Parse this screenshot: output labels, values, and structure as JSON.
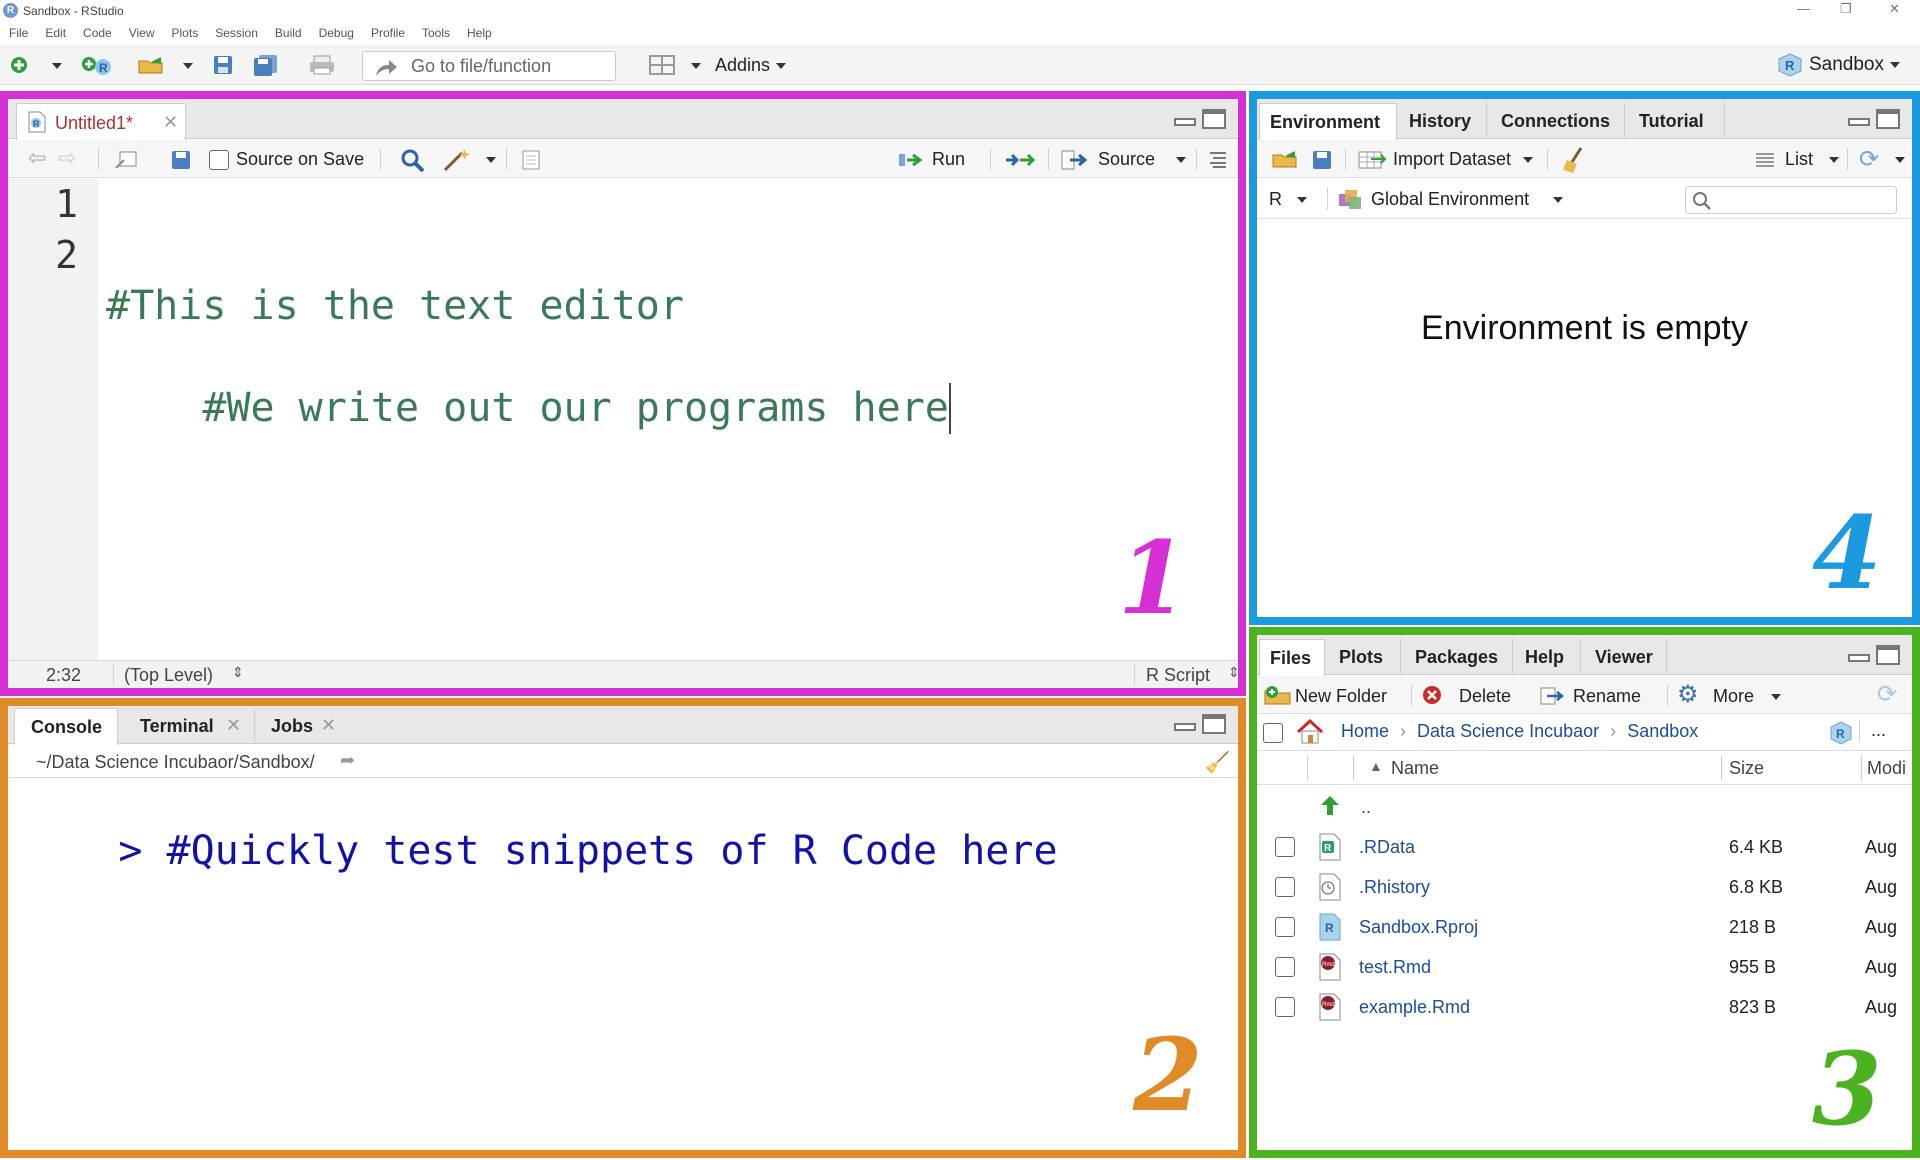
{
  "window": {
    "title": "Sandbox - RStudio"
  },
  "menu": [
    "File",
    "Edit",
    "Code",
    "View",
    "Plots",
    "Session",
    "Build",
    "Debug",
    "Profile",
    "Tools",
    "Help"
  ],
  "toolbar": {
    "goto_placeholder": "Go to file/function",
    "addins": "Addins",
    "project": "Sandbox"
  },
  "editor": {
    "tab": "Untitled1*",
    "source_on_save": "Source on Save",
    "run": "Run",
    "source": "Source",
    "lines": [
      "#This is the text editor",
      "#We write out our programs here"
    ],
    "line_numbers": [
      "1",
      "2"
    ],
    "position": "2:32",
    "scope": "(Top Level)",
    "file_type": "R Script",
    "region_number": "1"
  },
  "console": {
    "tabs": [
      "Console",
      "Terminal",
      "Jobs"
    ],
    "path": "~/Data Science Incubaor/Sandbox/",
    "prompt": ">",
    "command": "#Quickly test snippets of R Code here",
    "region_number": "2"
  },
  "environment": {
    "tabs": [
      "Environment",
      "History",
      "Connections",
      "Tutorial"
    ],
    "import_dataset": "Import Dataset",
    "view_mode": "List",
    "language": "R",
    "scope": "Global Environment",
    "empty_message": "Environment is empty",
    "region_number": "4"
  },
  "files": {
    "tabs": [
      "Files",
      "Plots",
      "Packages",
      "Help",
      "Viewer"
    ],
    "actions": {
      "new_folder": "New Folder",
      "delete": "Delete",
      "rename": "Rename",
      "more": "More"
    },
    "breadcrumb": [
      "Home",
      "Data Science Incubaor",
      "Sandbox"
    ],
    "ellipsis": "...",
    "columns": {
      "name": "Name",
      "size": "Size",
      "modified": "Modi"
    },
    "parent": "..",
    "rows": [
      {
        "name": ".RData",
        "size": "6.4 KB",
        "modified": "Aug",
        "icon": "rdata-icon"
      },
      {
        "name": ".Rhistory",
        "size": "6.8 KB",
        "modified": "Aug",
        "icon": "rhistory-icon"
      },
      {
        "name": "Sandbox.Rproj",
        "size": "218 B",
        "modified": "Aug",
        "icon": "rproj-icon"
      },
      {
        "name": "test.Rmd",
        "size": "955 B",
        "modified": "Aug",
        "icon": "rmd-icon"
      },
      {
        "name": "example.Rmd",
        "size": "823 B",
        "modified": "Aug",
        "icon": "rmd-icon"
      }
    ],
    "region_number": "3"
  },
  "colors": {
    "editor_region": "#d62fd4",
    "console_region": "#e08a28",
    "environment_region": "#1b9adf",
    "files_region": "#4cb21f",
    "comment_text": "#3a7a5a",
    "console_text": "#1212a8",
    "file_link": "#1a4d9c"
  }
}
